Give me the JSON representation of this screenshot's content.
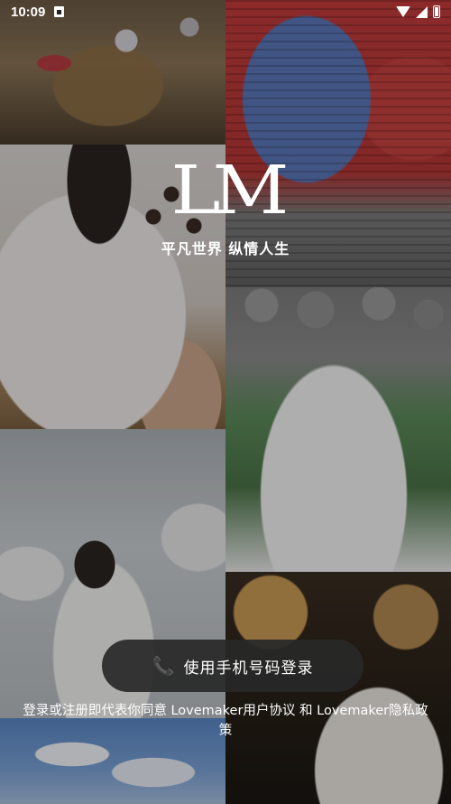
{
  "status_bar": {
    "time": "10:09",
    "icons": [
      "sim-card-icon",
      "wifi-icon",
      "signal-icon",
      "battery-icon"
    ]
  },
  "brand": {
    "logo": "LM",
    "slogan": "平凡世界 纵情人生"
  },
  "login": {
    "phone_icon": "📞",
    "phone_button_label": "使用手机号码登录"
  },
  "agreement": {
    "prefix": "登录或注册即代表你同意",
    "user_agreement": "Lovemaker用户协议",
    "connector": "和",
    "privacy_policy": "Lovemaker隐私政策"
  }
}
